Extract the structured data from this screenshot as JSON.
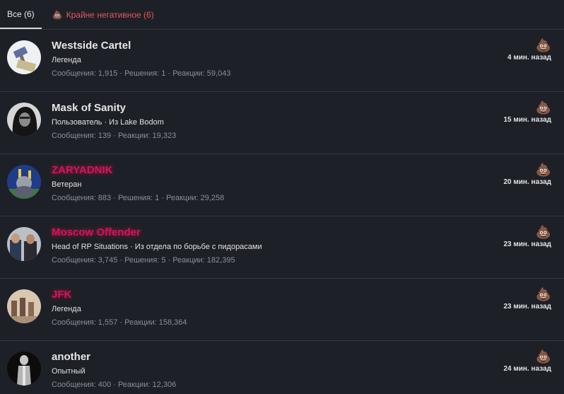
{
  "tabs": [
    {
      "label": "Все (6)"
    },
    {
      "icon": "poo-emoji",
      "emoji": "💩",
      "label": "Крайне негативное (6)"
    }
  ],
  "reaction_emoji": "💩",
  "users": [
    {
      "name": "Westside Cartel",
      "name_style": "normal",
      "title": "Легенда",
      "stats": "Сообщения: 1,915 · Решения: 1 · Реакции: 59,043",
      "time": "4 мин. назад"
    },
    {
      "name": "Mask of Sanity",
      "name_style": "normal",
      "title": "Пользователь · Из Lake Bodom",
      "stats": "Сообщения: 139 · Реакции: 19,323",
      "time": "15 мин. назад"
    },
    {
      "name": "ZARYADNIK",
      "name_style": "red-glow",
      "title": "Ветеран",
      "stats": "Сообщения: 883 · Решения: 1 · Реакции: 29,258",
      "time": "20 мин. назад"
    },
    {
      "name": "Moscow Offender",
      "name_style": "red-glow",
      "title": "Head of RP Situations · Из отдела по борьбе с пидорасами",
      "stats": "Сообщения: 3,745 · Решения: 5 · Реакции: 182,395",
      "time": "23 мин. назад"
    },
    {
      "name": "JFK",
      "name_style": "red-glow",
      "title": "Легенда",
      "stats": "Сообщения: 1,557 · Реакции: 158,364",
      "time": "23 мин. назад"
    },
    {
      "name": "another",
      "name_style": "normal",
      "title": "Опытный",
      "stats": "Сообщения: 400 · Реакции: 12,306",
      "time": "24 мин. назад"
    }
  ],
  "colors": {
    "background": "#1e2028",
    "divider": "#33363f",
    "negative": "#e05a5a",
    "highlight_name": "#d4135a",
    "muted": "#8b8e96"
  }
}
